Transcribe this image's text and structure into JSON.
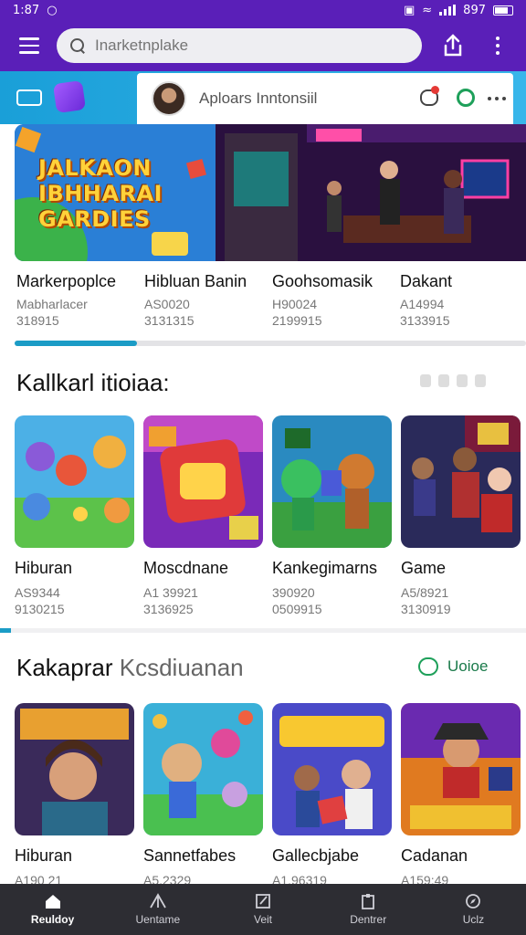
{
  "status_bar": {
    "time": "1:87",
    "battery": "897"
  },
  "search": {
    "placeholder": "Inarketnplake"
  },
  "user_card": {
    "name": "Aploars Inntonsiil"
  },
  "banner": {
    "title": "JALKAON IBHHARAI GARDIES"
  },
  "carousel": [
    {
      "title": "Markerpoplce",
      "sub1": "Mabharlacer",
      "sub2": "318915"
    },
    {
      "title": "Hibluan Banin",
      "sub1": "AS0020",
      "sub2": "3131315"
    },
    {
      "title": "Goohsomasik",
      "sub1": "H90024",
      "sub2": "2199915"
    },
    {
      "title": "Dakant",
      "sub1": "A14994",
      "sub2": "3133915"
    }
  ],
  "carousel_progress": 0.24,
  "section1": {
    "title": "Kallkarl itioiaa:",
    "cards": [
      {
        "title": "Hiburan",
        "sub1": "AS9344",
        "sub2": "9130215",
        "icon": "cartoon-animals"
      },
      {
        "title": "Moscdnane",
        "sub1": "A1 39921",
        "sub2": "3136925",
        "icon": "puzzle-box"
      },
      {
        "title": "Kankegimarns",
        "sub1": "390920",
        "sub2": "0509915",
        "icon": "leprechaun-cards"
      },
      {
        "title": "Game",
        "sub1": "A5/8921",
        "sub2": "3130919",
        "icon": "arcade-heroes"
      }
    ]
  },
  "section2": {
    "title_dark": "Kakaprar",
    "title_light": "Kcsdiuanan",
    "more_label": "Uoioe",
    "cards": [
      {
        "title": "Hiburan",
        "sub1": "A190 21",
        "icon": "woman-logo"
      },
      {
        "title": "Sannetfabes",
        "sub1": "A5.2329",
        "icon": "bear-girl"
      },
      {
        "title": "Gallecbjabe",
        "sub1": "A1.96319",
        "icon": "woudoy-game"
      },
      {
        "title": "Cadanan",
        "sub1": "A159:49",
        "icon": "pirate-dice"
      }
    ]
  },
  "bottom_nav": [
    {
      "label": "Reuldoy",
      "icon": "home-icon"
    },
    {
      "label": "Uentame",
      "icon": "tent-icon"
    },
    {
      "label": "Veit",
      "icon": "edit-icon"
    },
    {
      "label": "Dentrer",
      "icon": "clipboard-icon"
    },
    {
      "label": "Uclz",
      "icon": "compass-icon"
    }
  ],
  "colors": {
    "brand": "#5a1fb8",
    "accent": "#1b9cc6",
    "green": "#1ea05a"
  }
}
